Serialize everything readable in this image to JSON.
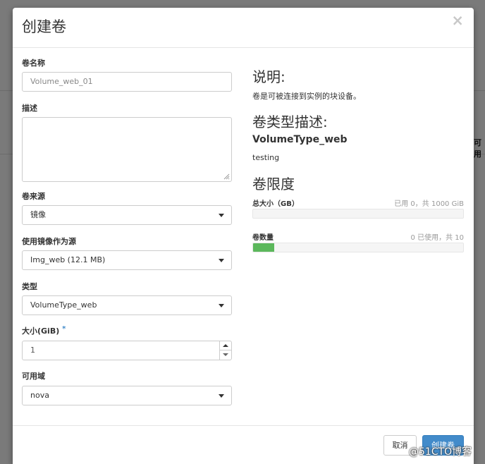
{
  "background": {
    "peek_text": "可用"
  },
  "modal": {
    "title": "创建卷",
    "close_glyph": "×"
  },
  "form": {
    "volume_name": {
      "label": "卷名称",
      "placeholder": "Volume_web_01"
    },
    "description": {
      "label": "描述",
      "value": ""
    },
    "volume_source": {
      "label": "卷来源",
      "selected": "镜像"
    },
    "image_source": {
      "label": "使用镜像作为源",
      "selected": "Img_web (12.1 MB)"
    },
    "type": {
      "label": "类型",
      "selected": "VolumeType_web"
    },
    "size": {
      "label": "大小(GiB)",
      "required_mark": "*",
      "value": "1"
    },
    "availability_zone": {
      "label": "可用域",
      "selected": "nova"
    }
  },
  "info": {
    "description_heading": "说明:",
    "description_text": "卷是可被连接到实例的块设备。",
    "type_heading": "卷类型描述:",
    "type_name": "VolumeType_web",
    "type_desc": "testing",
    "limits_heading": "卷限度",
    "total_size": {
      "label": "总大小（GB）",
      "value": "已用 0，共 1000 GiB",
      "fraction": 0.0
    },
    "volume_count": {
      "label": "卷数量",
      "value": "0 已使用，共 10",
      "fraction": 0.1
    }
  },
  "footer": {
    "cancel_label": "取消",
    "create_label": "创建卷"
  },
  "watermark": "@51CTO博客",
  "colors": {
    "primary": "#428bca",
    "progress": "#5cb85c",
    "required": "#428bca"
  }
}
